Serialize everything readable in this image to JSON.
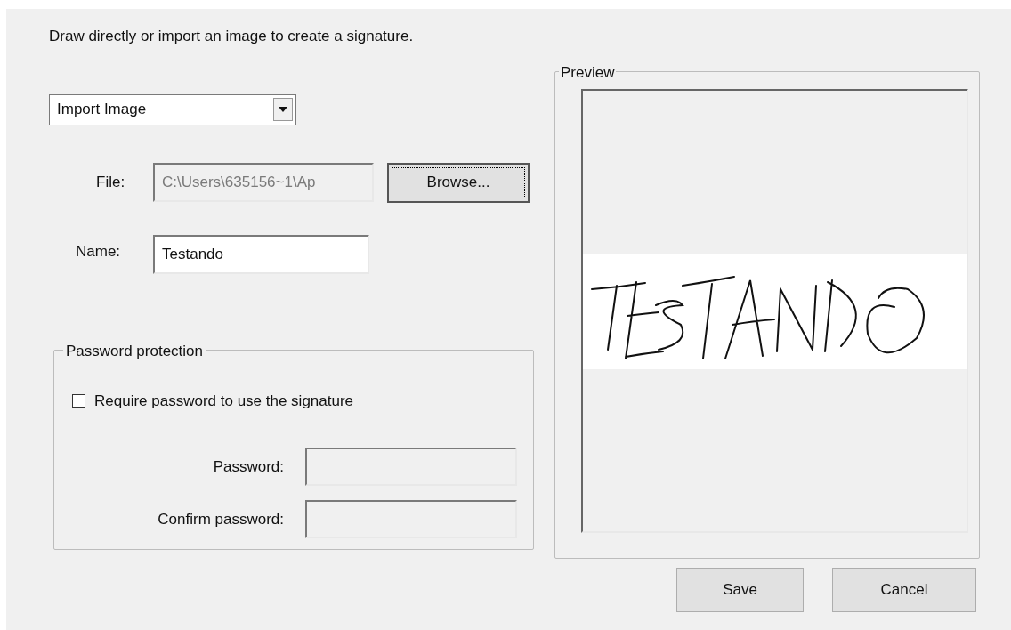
{
  "instruction": "Draw directly or import an image to create a signature.",
  "mode_select": {
    "value": "Import Image"
  },
  "file": {
    "label": "File:",
    "value": "C:\\Users\\635156~1\\Ap",
    "disabled": true
  },
  "browse_button": {
    "label": "Browse...",
    "focused": true
  },
  "name": {
    "label": "Name:",
    "value": "Testando",
    "disabled": false
  },
  "password_protection": {
    "title": "Password protection",
    "require": {
      "label": "Require password to use the signature",
      "checked": false
    },
    "fields": [
      {
        "label": "Password:",
        "disabled": true
      },
      {
        "label": "Confirm password:",
        "disabled": true
      }
    ]
  },
  "preview": {
    "title": "Preview"
  },
  "buttons": [
    {
      "label": "Save"
    },
    {
      "label": "Cancel"
    }
  ]
}
